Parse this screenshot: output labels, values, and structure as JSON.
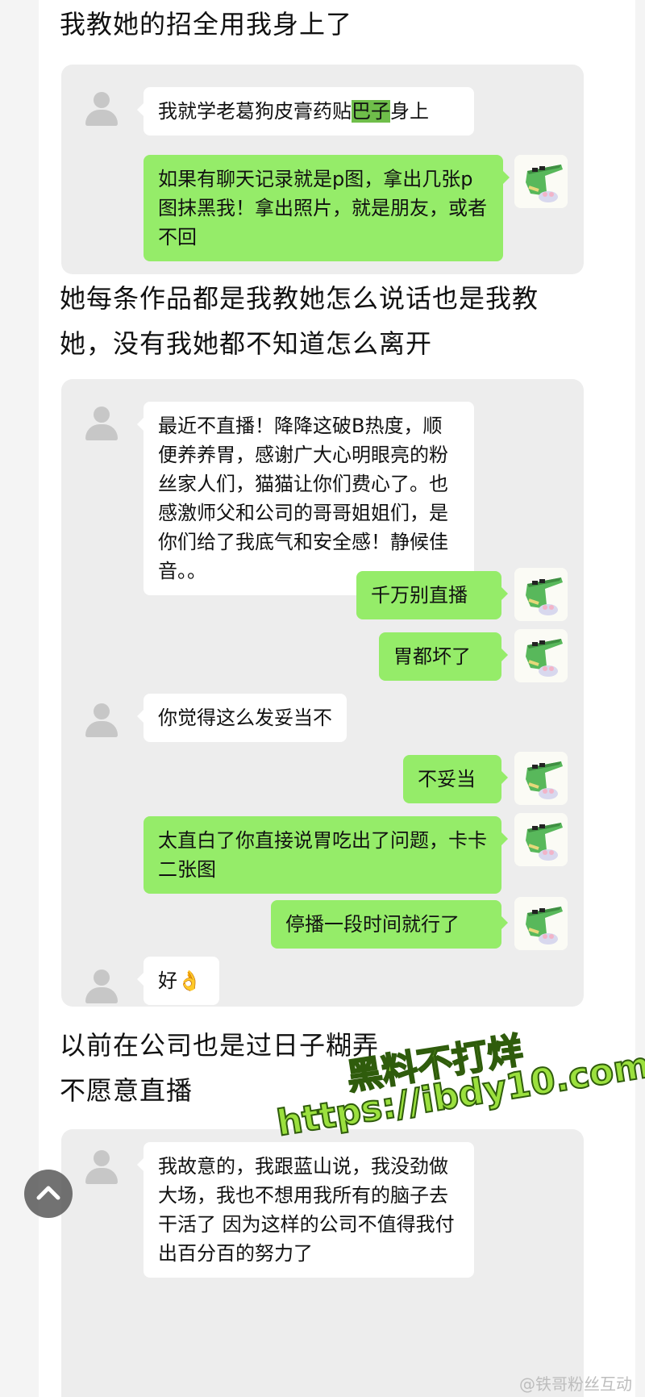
{
  "sections": {
    "intro_1": "我教她的招全用我身上了",
    "intro_2_line1": "她每条作品都是我教她怎么说话也是我教",
    "intro_2_line2": "她，没有我她都不知道怎么离开",
    "intro_3_line1": "以前在公司也是过日子糊弄",
    "intro_3_line2": "不愿意直播"
  },
  "chat1": {
    "m1_pre": "我就学老葛狗皮膏药贴",
    "m1_hl": "巴子",
    "m1_post": "身上",
    "m2": "如果有聊天记录就是p图，拿出几张p图抹黑我！拿出照片，就是朋友，或者不回"
  },
  "chat2": {
    "m1": "最近不直播！降降这破B热度，顺便养养胃，感谢广大心明眼亮的粉丝家人们，猫猫让你们费心了。也感激师父和公司的哥哥姐姐们，是你们给了我底气和安全感！静候佳音。。",
    "m2": "千万别直播",
    "m3": "胃都坏了",
    "m4": "你觉得这么发妥当不",
    "m5": "不妥当",
    "m6": "太直白了你直接说胃吃出了问题，卡卡二张图",
    "m7": "停播一段时间就行了",
    "m8": "好👌"
  },
  "chat3": {
    "m1": "我故意的，我跟蓝山说，我没劲做大场，我也不想用我所有的脑子去干活了 因为这样的公司不值得我付出百分百的努力了"
  },
  "watermark": {
    "line1": "黑料不打烊",
    "line2": "https://ibdy10.com"
  },
  "footer": {
    "credit": "@铁哥粉丝互动"
  },
  "colors": {
    "bubble_green": "#95ec69",
    "bubble_white": "#ffffff",
    "card_bg": "#ededed"
  },
  "icons": {
    "scroll_top": "chevron-up-icon",
    "default_avatar": "person-silhouette-icon",
    "croc_avatar": "crocodile-avatar-icon"
  }
}
